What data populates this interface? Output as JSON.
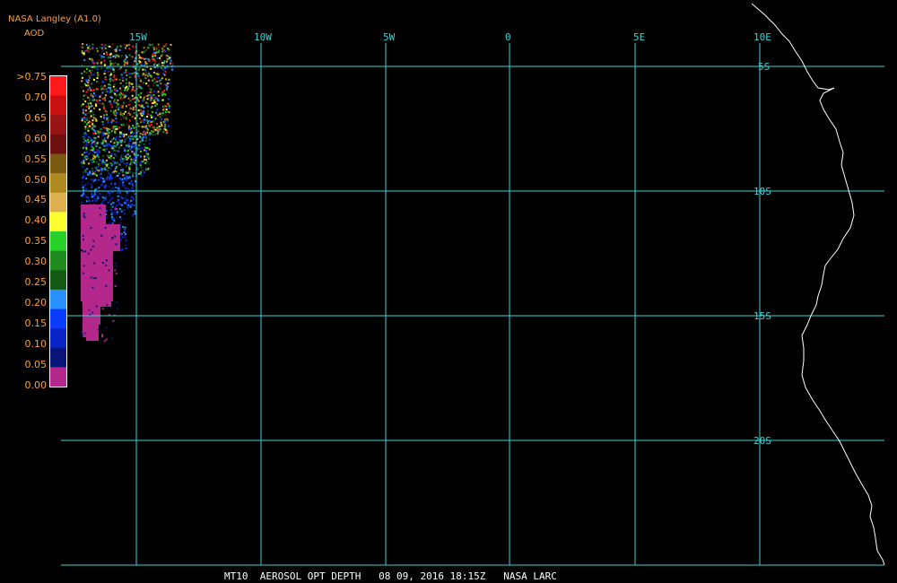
{
  "header": {
    "source": "NASA Langley (A1.0)",
    "product": "AOD"
  },
  "colorbar": {
    "labels": [
      ">0.75",
      "0.70",
      "0.65",
      "0.60",
      "0.55",
      "0.50",
      "0.45",
      "0.40",
      "0.35",
      "0.30",
      "0.25",
      "0.20",
      "0.15",
      "0.10",
      "0.05",
      "0.00"
    ],
    "colors": [
      "#ff1a1a",
      "#c81010",
      "#961414",
      "#6e1010",
      "#7a5a10",
      "#b08a20",
      "#e0b050",
      "#ffff30",
      "#28d228",
      "#1e8c1e",
      "#145a14",
      "#2890ff",
      "#0a3cff",
      "#0a23c8",
      "#0a1478",
      "#b4288c"
    ],
    "label_color": "#ff9f3a"
  },
  "grid": {
    "longitudes": [
      "15W",
      "10W",
      "5W",
      "0",
      "5E",
      "10E"
    ],
    "latitudes": [
      "5S",
      "10S",
      "15S",
      "20S"
    ],
    "line_color": "#39d4d4"
  },
  "footer": "MT10  AEROSOL OPT DEPTH   08 09, 2016 18:15Z   NASA LARC"
}
